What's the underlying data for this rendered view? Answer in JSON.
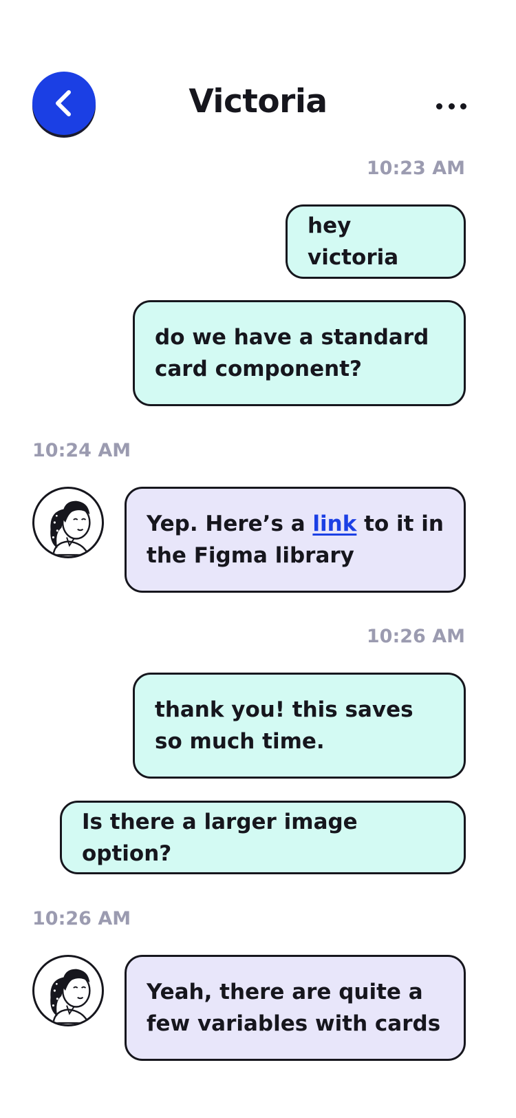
{
  "header": {
    "back_icon": "chevron-left-icon",
    "title": "Victoria",
    "more_icon": "more-horizontal-icon"
  },
  "colors": {
    "accent": "#1b3fe4",
    "sent_bubble": "#d3faf3",
    "received_bubble": "#e8e6fa",
    "timestamp": "#9b9bb0",
    "outline": "#16161d"
  },
  "messages": [
    {
      "timestamp": "10:23 AM"
    },
    {
      "text": "hey victoria"
    },
    {
      "text": "do we have a standard card component?"
    },
    {
      "timestamp": "10:24 AM"
    },
    {
      "pre": "Yep. Here’s a ",
      "link": "link",
      "post": " to it in the Figma library"
    },
    {
      "timestamp": "10:26 AM"
    },
    {
      "text": "thank you! this saves so much time."
    },
    {
      "text": "Is there a larger image option?"
    },
    {
      "timestamp": "10:26 AM"
    },
    {
      "text": "Yeah, there are quite a few variables with cards"
    }
  ]
}
